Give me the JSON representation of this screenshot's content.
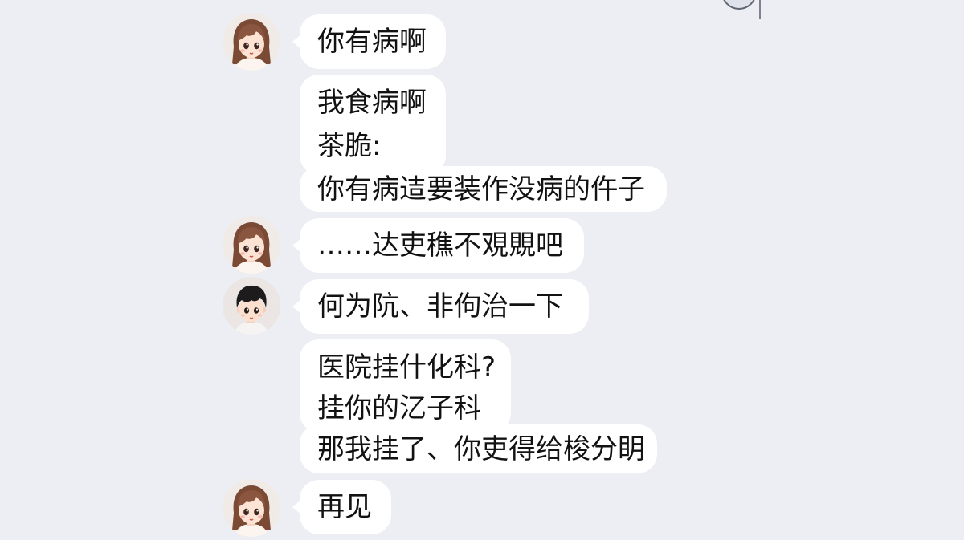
{
  "colors": {
    "background": "#eceef4",
    "bubble": "#ffffff",
    "text": "#121212",
    "girl_hair": "#7a4a35",
    "boy_hair": "#1d1b1b"
  },
  "top_right_icon": "partial-avatar-icon",
  "messages": [
    {
      "avatar": "girl-avatar-icon",
      "lines": [
        "你有病啊"
      ]
    },
    {
      "lines": [
        "我食病啊",
        "茶脆:",
        "你有病迼要装作没病的仵子"
      ]
    },
    {
      "avatar": "girl-avatar-icon",
      "lines": [
        "……达吏穛不覌覞吧"
      ]
    },
    {
      "avatar": "boy-avatar-icon",
      "lines": [
        "何为阬、非佝治一下"
      ]
    },
    {
      "lines": [
        "医院挂什化科?",
        "挂你的㲸子科",
        "那我挂了、你吏得给梭分眀"
      ]
    },
    {
      "avatar": "girl-avatar-icon",
      "lines": [
        "再见"
      ]
    }
  ]
}
